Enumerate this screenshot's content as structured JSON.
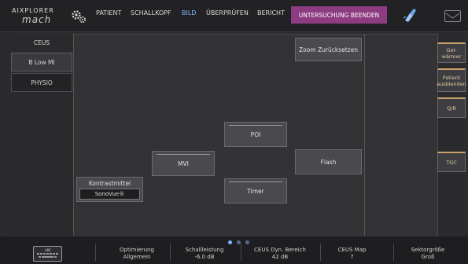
{
  "header": {
    "logo_line1": "AIXPLORER",
    "logo_line2": "mach",
    "menu": [
      {
        "label": "PATIENT"
      },
      {
        "label": "SCHALLKOPF"
      },
      {
        "label": "BILD"
      },
      {
        "label": "ÜBERPRÜFEN"
      },
      {
        "label": "BERICHT"
      }
    ],
    "end_exam": "UNTERSUCHUNG BEENDEN",
    "end_exam_color": "#8e3c82",
    "active_menu_color": "#7fb6ff"
  },
  "left_tabs": [
    {
      "label": "CEUS"
    },
    {
      "label": "B Low MI"
    },
    {
      "label": "PHYSIO"
    }
  ],
  "buttons": {
    "zoom_reset": "Zoom Zurücksetzen",
    "poi": "POI",
    "mvi": "MVI",
    "flash": "Flash",
    "timer": "Timer"
  },
  "contrast": {
    "label": "Kontrastmittel",
    "value": "SonoVue®"
  },
  "side_buttons": {
    "gel": "Gel-\nwärmer",
    "patient_hide": "Patient\nausblenden",
    "qr": "Q/R",
    "tgc": "TGC"
  },
  "bottom": {
    "keyboard_label": "ABC",
    "items": [
      {
        "title": "Optimierung",
        "value": "Allgemein"
      },
      {
        "title": "Schallleistung",
        "value": "-6.0 dB"
      },
      {
        "title": "CEUS Dyn. Bereich",
        "value": "42 dB"
      },
      {
        "title": "CEUS Map",
        "value": "7"
      },
      {
        "title": "Sektorgröße",
        "value": "Groß"
      }
    ],
    "pager_active_color": "#7fb6ff",
    "pager_inactive_color": "#5a6a8a"
  }
}
